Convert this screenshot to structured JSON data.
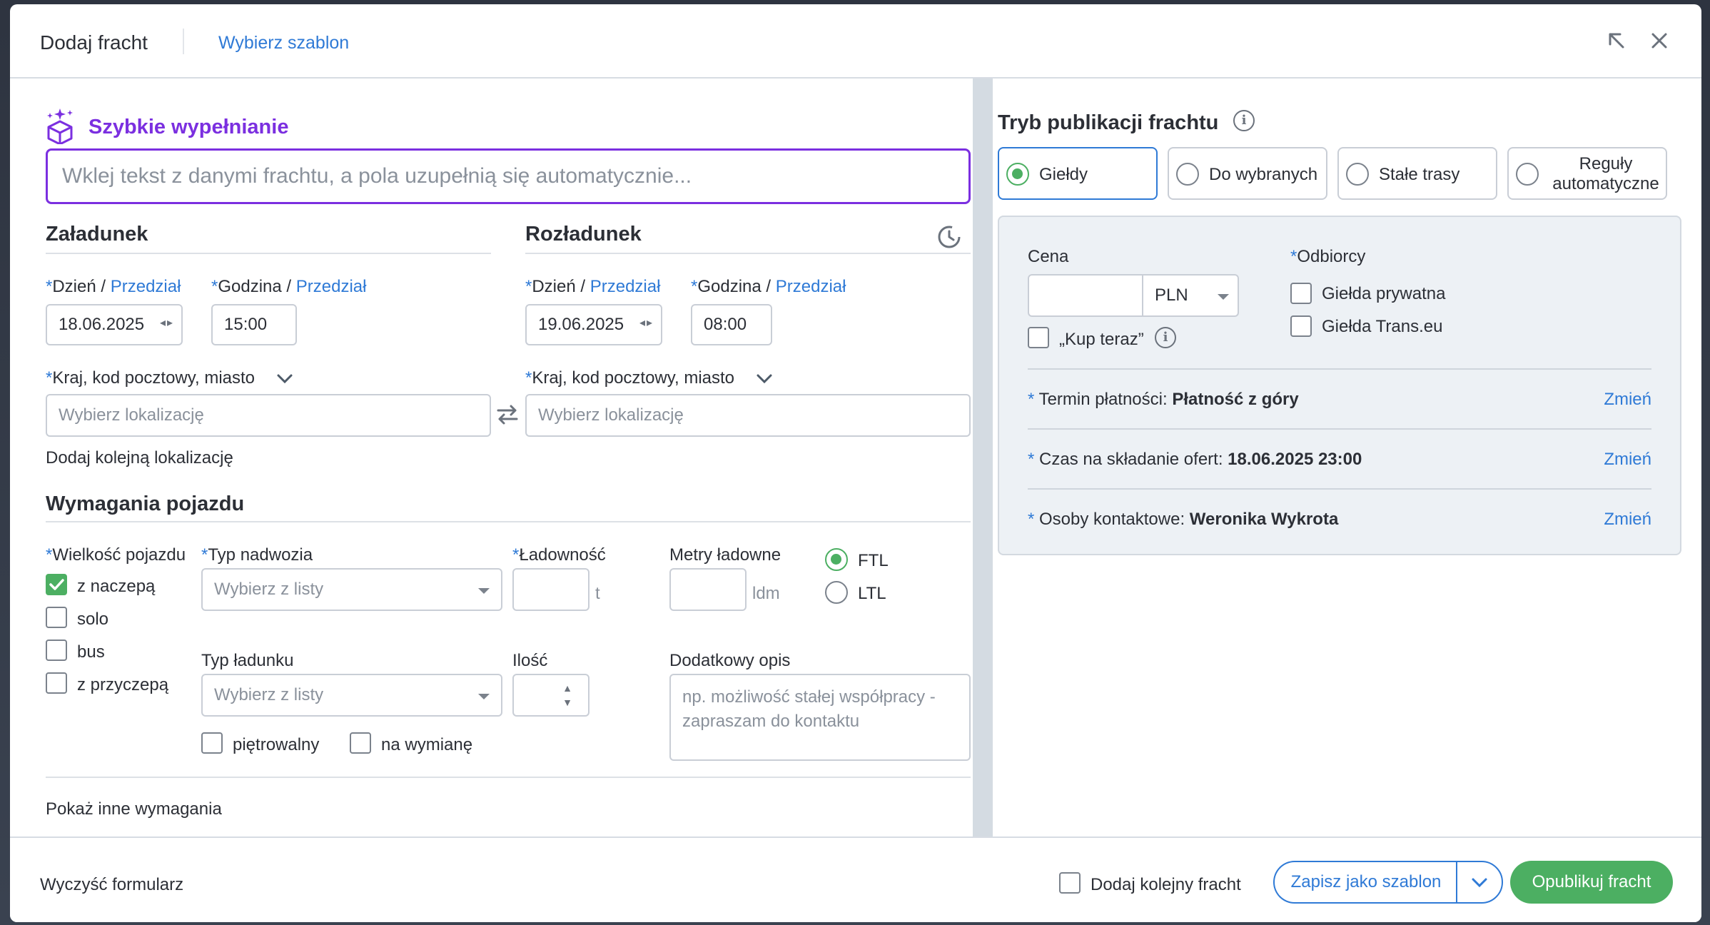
{
  "header": {
    "title": "Dodaj fracht",
    "template_link": "Wybierz szablon"
  },
  "quick_fill": {
    "title": "Szybkie wypełnianie",
    "placeholder": "Wklej tekst z danymi frachtu, a pola uzupełnią się automatycznie..."
  },
  "loading": {
    "title": "Załadunek",
    "day_label": "Dzień",
    "time_label": "Godzina",
    "range_link": "Przedział",
    "slash": "/",
    "date": "18.06.2025",
    "time": "15:00",
    "location_label": "Kraj, kod pocztowy, miasto",
    "location_placeholder": "Wybierz lokalizację",
    "add_location": "Dodaj kolejną lokalizację"
  },
  "unloading": {
    "title": "Rozładunek",
    "day_label": "Dzień",
    "time_label": "Godzina",
    "range_link": "Przedział",
    "slash": "/",
    "date": "19.06.2025",
    "time": "08:00",
    "location_label": "Kraj, kod pocztowy, miasto",
    "location_placeholder": "Wybierz lokalizację"
  },
  "vehicle": {
    "title": "Wymagania pojazdu",
    "size_label": "Wielkość pojazdu",
    "sizes": [
      {
        "label": "z naczepą",
        "checked": true
      },
      {
        "label": "solo",
        "checked": false
      },
      {
        "label": "bus",
        "checked": false
      },
      {
        "label": "z przyczepą",
        "checked": false
      }
    ],
    "body_label": "Typ nadwozia",
    "body_placeholder": "Wybierz z listy",
    "capacity_label": "Ładowność",
    "capacity_unit": "t",
    "ldm_label": "Metry ładowne",
    "ldm_unit": "ldm",
    "ftl_label": "FTL",
    "ltl_label": "LTL",
    "cargo_label": "Typ ładunku",
    "cargo_placeholder": "Wybierz z listy",
    "qty_label": "Ilość",
    "desc_label": "Dodatkowy opis",
    "desc_placeholder": "np. możliwość stałej współpracy - zapraszam do kontaktu",
    "stackable": "piętrowalny",
    "exchange": "na wymianę",
    "more_link": "Pokaż inne wymagania"
  },
  "publication": {
    "title": "Tryb publikacji frachtu",
    "modes": [
      "Giełdy",
      "Do wybranych",
      "Stałe trasy",
      "Reguły automatyczne"
    ],
    "selected_mode": "Giełdy",
    "price_label": "Cena",
    "currency": "PLN",
    "buy_now": "„Kup teraz”",
    "recipients_label": "Odbiorcy",
    "recipients": [
      "Giełda prywatna",
      "Giełda Trans.eu"
    ],
    "payment_label": "Termin płatności:",
    "payment_value": "Płatność z góry",
    "offers_label": "Czas na składanie ofert:",
    "offers_value": "18.06.2025 23:00",
    "contact_label": "Osoby kontaktowe:",
    "contact_value": "Weronika Wykrota",
    "change": "Zmień"
  },
  "footer": {
    "clear": "Wyczyść formularz",
    "add_another": "Dodaj kolejny fracht",
    "save_template": "Zapisz jako szablon",
    "publish": "Opublikuj fracht"
  },
  "colors": {
    "accent_blue": "#2f7ad6",
    "accent_purple": "#7b2fe0",
    "success_green": "#4caf62"
  }
}
